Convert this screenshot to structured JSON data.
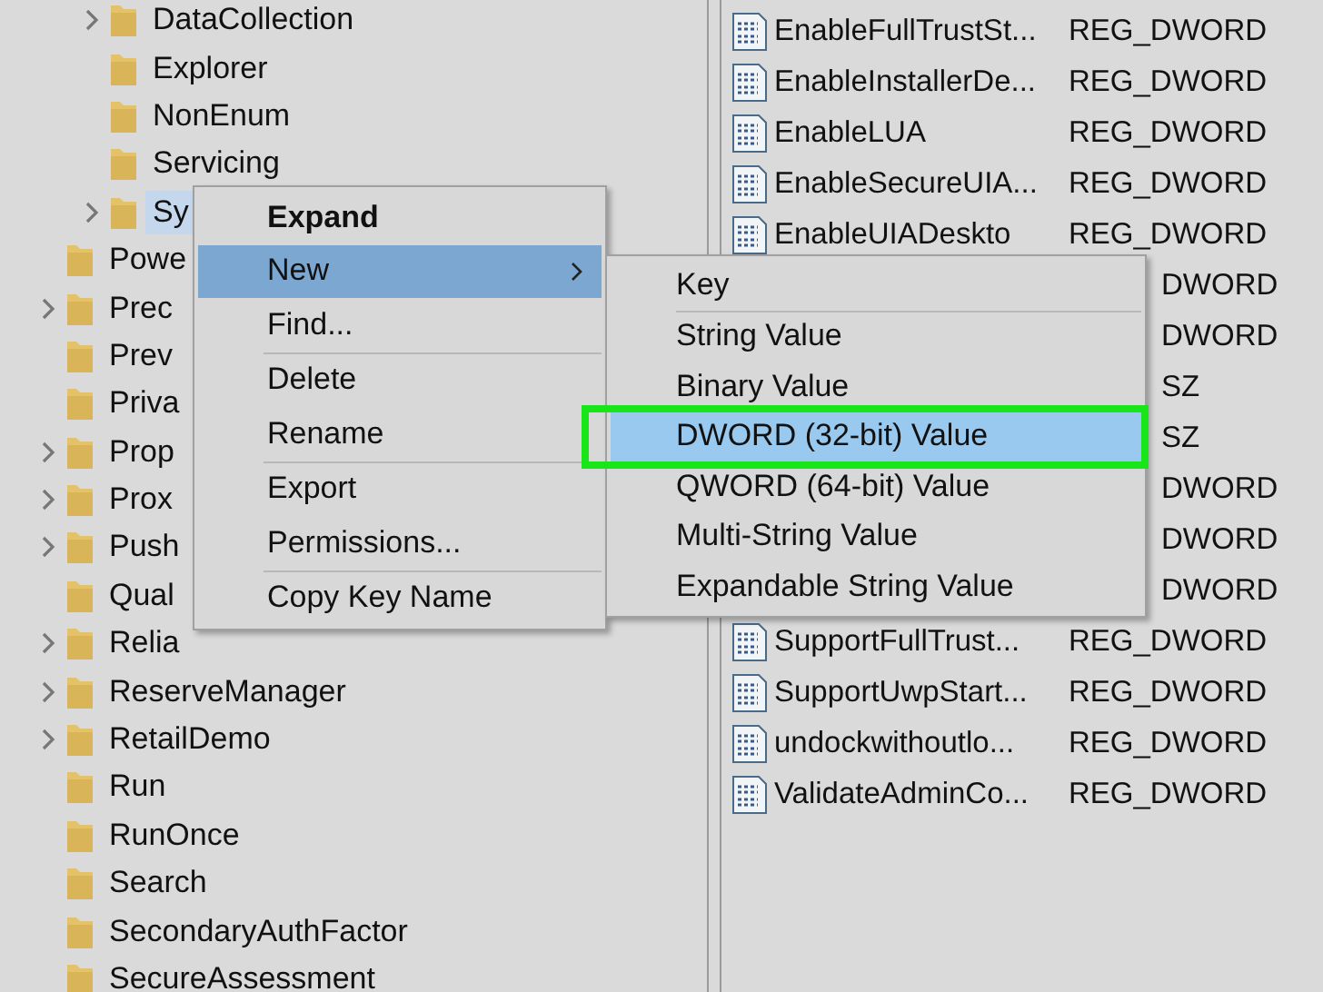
{
  "tree": [
    {
      "children": [
        {
          "label": "DataCollection",
          "expandable": true,
          "selected": false
        },
        {
          "label": "Explorer",
          "expandable": false,
          "selected": false
        },
        {
          "label": "NonEnum",
          "expandable": false,
          "selected": false
        },
        {
          "label": "Servicing",
          "expandable": false,
          "selected": false
        },
        {
          "label": "Sy",
          "expandable": true,
          "selected": true
        }
      ]
    },
    {
      "label": "Powe",
      "expandable": false,
      "selected": false
    },
    {
      "label": "Prec",
      "expandable": true,
      "selected": false
    },
    {
      "label": "Prev",
      "expandable": false,
      "selected": false
    },
    {
      "label": "Priva",
      "expandable": false,
      "selected": false
    },
    {
      "label": "Prop",
      "expandable": true,
      "selected": false
    },
    {
      "label": "Prox",
      "expandable": true,
      "selected": false
    },
    {
      "label": "Push",
      "expandable": true,
      "selected": false
    },
    {
      "label": "Qual",
      "expandable": false,
      "selected": false
    },
    {
      "label": "Relia",
      "expandable": true,
      "selected": false
    },
    {
      "label": "ReserveManager",
      "expandable": true,
      "selected": false
    },
    {
      "label": "RetailDemo",
      "expandable": true,
      "selected": false
    },
    {
      "label": "Run",
      "expandable": false,
      "selected": false
    },
    {
      "label": "RunOnce",
      "expandable": false,
      "selected": false
    },
    {
      "label": "Search",
      "expandable": false,
      "selected": false
    },
    {
      "label": "SecondaryAuthFactor",
      "expandable": false,
      "selected": false
    },
    {
      "label": "SecureAssessment",
      "expandable": false,
      "selected": false
    }
  ],
  "values": [
    {
      "name": "EnableFullTrustSt...",
      "type": "REG_DWORD"
    },
    {
      "name": "EnableInstallerDe...",
      "type": "REG_DWORD"
    },
    {
      "name": "EnableLUA",
      "type": "REG_DWORD"
    },
    {
      "name": "EnableSecureUIA...",
      "type": "REG_DWORD"
    },
    {
      "name": "EnableUIADeskto",
      "type": "REG_DWORD"
    },
    {
      "type": "DWORD"
    },
    {
      "type": "DWORD"
    },
    {
      "type": "SZ"
    },
    {
      "type": "SZ"
    },
    {
      "type": "DWORD"
    },
    {
      "type": "DWORD"
    },
    {
      "type": "DWORD"
    },
    {
      "name": "SupportFullTrust...",
      "type": "REG_DWORD"
    },
    {
      "name": "SupportUwpStart...",
      "type": "REG_DWORD"
    },
    {
      "name": "undockwithoutlo...",
      "type": "REG_DWORD"
    },
    {
      "name": "ValidateAdminCo...",
      "type": "REG_DWORD"
    }
  ],
  "context_menu": [
    {
      "label": "Expand",
      "kind": "default",
      "selected": false
    },
    {
      "label": "New",
      "kind": "submenu",
      "selected": true
    },
    {
      "label": "Find...",
      "kind": "item",
      "selected": false
    },
    {
      "kind": "separator"
    },
    {
      "label": "Delete",
      "kind": "item",
      "selected": false
    },
    {
      "label": "Rename",
      "kind": "item",
      "selected": false
    },
    {
      "kind": "separator"
    },
    {
      "label": "Export",
      "kind": "item",
      "selected": false
    },
    {
      "label": "Permissions...",
      "kind": "item",
      "selected": false
    },
    {
      "kind": "separator"
    },
    {
      "label": "Copy Key Name",
      "kind": "item",
      "selected": false
    }
  ],
  "submenu": [
    {
      "label": "Key",
      "kind": "item",
      "selected": false
    },
    {
      "kind": "separator"
    },
    {
      "label": "String Value",
      "kind": "item",
      "selected": false
    },
    {
      "label": "Binary Value",
      "kind": "item",
      "selected": false
    },
    {
      "label": "DWORD (32-bit) Value",
      "kind": "item",
      "selected": true
    },
    {
      "label": "QWORD (64-bit) Value",
      "kind": "item",
      "selected": false
    },
    {
      "label": "Multi-String Value",
      "kind": "item",
      "selected": false
    },
    {
      "label": "Expandable String Value",
      "kind": "item",
      "selected": false
    }
  ]
}
